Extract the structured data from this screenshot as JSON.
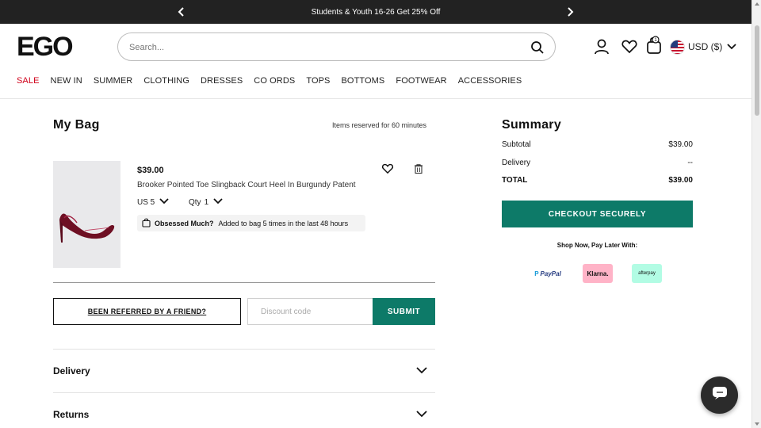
{
  "promo": {
    "text": "Students & Youth 16-26 Get 25% Off"
  },
  "header": {
    "logo": "EGO",
    "search_placeholder": "Search...",
    "currency": "USD ($)"
  },
  "nav": {
    "items": [
      "SALE",
      "NEW IN",
      "SUMMER",
      "CLOTHING",
      "DRESSES",
      "CO ORDS",
      "TOPS",
      "BOTTOMS",
      "FOOTWEAR",
      "ACCESSORIES"
    ]
  },
  "bag": {
    "title": "My Bag",
    "reserved_note": "Items reserved for 60 minutes",
    "item": {
      "price": "$39.00",
      "name": "Brooker Pointed Toe Slingback Court Heel In Burgundy Patent",
      "size": "US 5",
      "qty_label": "Qty",
      "qty": "1",
      "obsessed_title": "Obsessed Much?",
      "obsessed_text": "Added to bag 5 times in the last 48 hours"
    },
    "referred_label": "BEEN REFERRED BY A FRIEND?",
    "discount_placeholder": "Discount code",
    "submit_label": "SUBMIT",
    "accordions": [
      "Delivery",
      "Returns"
    ]
  },
  "summary": {
    "title": "Summary",
    "rows": [
      {
        "label": "Subtotal",
        "value": "$39.00"
      },
      {
        "label": "Delivery",
        "value": "--"
      },
      {
        "label": "TOTAL",
        "value": "$39.00"
      }
    ],
    "checkout_label": "CHECKOUT SECURELY",
    "paylater_label": "Shop Now, Pay Later With:",
    "paypal": "PayPal",
    "klarna": "Klarna.",
    "afterpay": "afterpay"
  },
  "colors": {
    "accent": "#0d7a68",
    "sale": "#d0021b",
    "promo_bg": "#222222"
  },
  "icons": [
    "chevron-left-icon",
    "chevron-right-icon",
    "search-icon",
    "user-icon",
    "heart-icon",
    "bag-icon",
    "us-flag-icon",
    "chevron-down-icon",
    "trash-icon",
    "chat-icon"
  ]
}
